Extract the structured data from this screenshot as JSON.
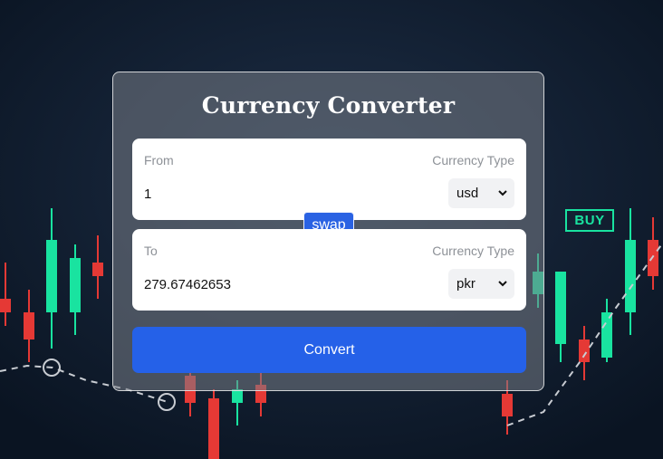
{
  "app": {
    "title": "Currency Converter"
  },
  "from": {
    "label": "From",
    "type_label": "Currency Type",
    "amount": "1",
    "currency": "usd"
  },
  "swap_label": "swap",
  "to": {
    "label": "To",
    "type_label": "Currency Type",
    "amount": "279.67462653",
    "currency": "pkr"
  },
  "convert_label": "Convert",
  "background": {
    "badge": "BUY"
  },
  "colors": {
    "accent": "#2561e8",
    "bull_candle": "#19e3a0",
    "bear_candle": "#e53935",
    "background": "#0d1a2b"
  }
}
